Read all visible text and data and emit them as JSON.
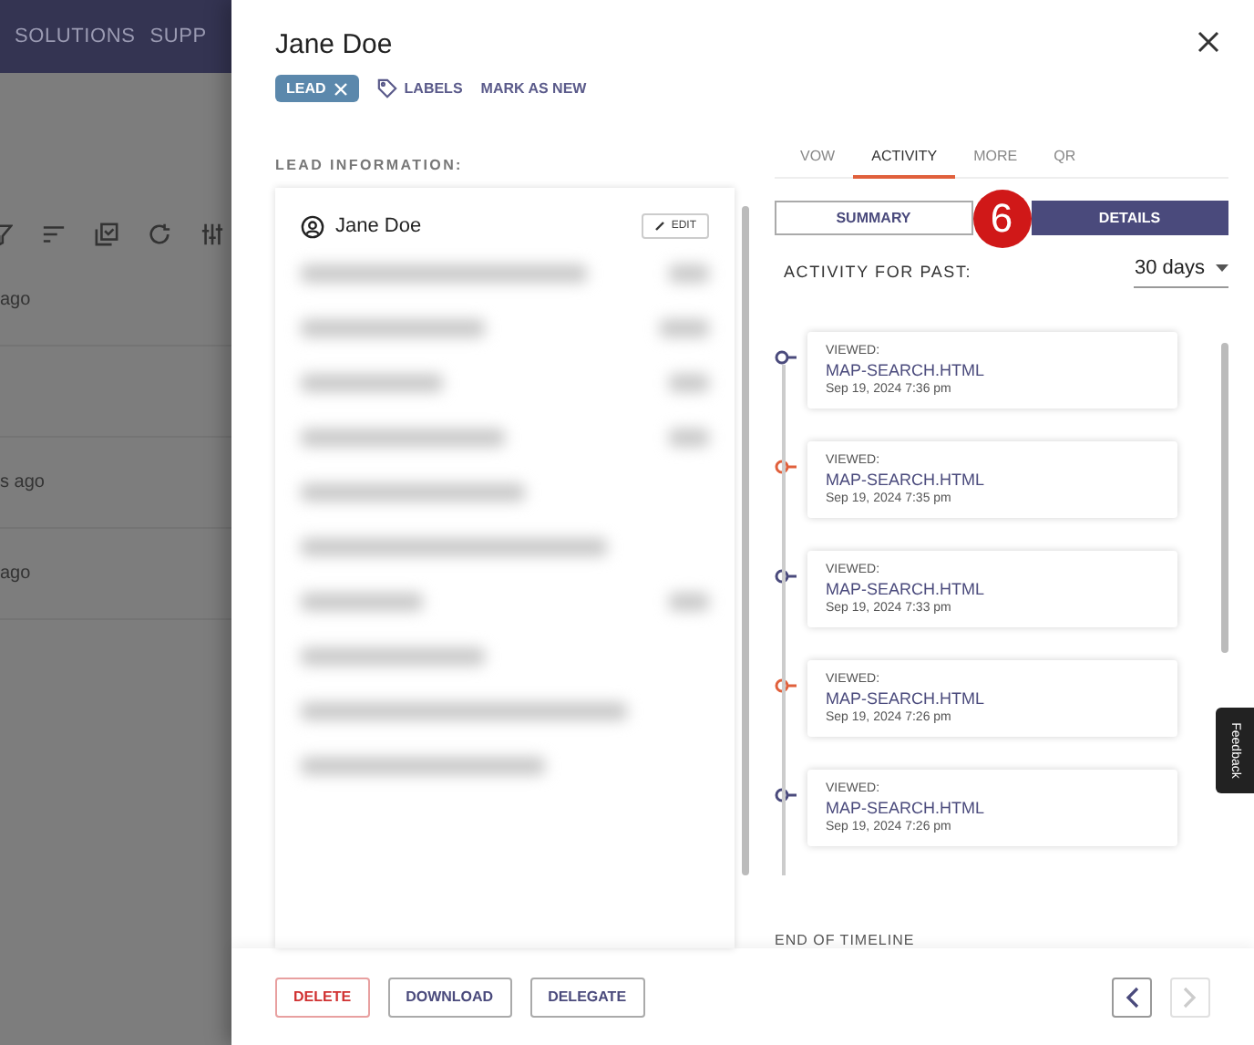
{
  "background_app": {
    "nav_items": [
      "SOLUTIONS",
      "SUPP"
    ],
    "rows": [
      "ago",
      "s ago",
      "ago"
    ]
  },
  "panel": {
    "title": "Jane Doe",
    "status_chip": "LEAD",
    "labels_link": "LABELS",
    "mark_new_link": "MARK AS NEW"
  },
  "lead_info": {
    "heading": "LEAD INFORMATION:",
    "name": "Jane Doe",
    "edit_button": "EDIT"
  },
  "tabs": [
    {
      "label": "VOW",
      "selected": false
    },
    {
      "label": "ACTIVITY",
      "selected": true
    },
    {
      "label": "MORE",
      "selected": false
    },
    {
      "label": "QR",
      "selected": false
    }
  ],
  "view_toggle": [
    {
      "label": "SUMMARY",
      "selected": false
    },
    {
      "label": "DETAILS",
      "selected": true
    }
  ],
  "annotation_badge": "6",
  "activity_filter": {
    "label": "ACTIVITY FOR PAST:",
    "value": "30 days"
  },
  "timeline": [
    {
      "action": "VIEWED:",
      "page": "MAP-SEARCH.HTML",
      "time": "Sep 19, 2024 7:36 pm",
      "color": "#4a4a7c"
    },
    {
      "action": "VIEWED:",
      "page": "MAP-SEARCH.HTML",
      "time": "Sep 19, 2024 7:35 pm",
      "color": "#e0603c"
    },
    {
      "action": "VIEWED:",
      "page": "MAP-SEARCH.HTML",
      "time": "Sep 19, 2024 7:33 pm",
      "color": "#4a4a7c"
    },
    {
      "action": "VIEWED:",
      "page": "MAP-SEARCH.HTML",
      "time": "Sep 19, 2024 7:26 pm",
      "color": "#e0603c"
    },
    {
      "action": "VIEWED:",
      "page": "MAP-SEARCH.HTML",
      "time": "Sep 19, 2024 7:26 pm",
      "color": "#4a4a7c"
    }
  ],
  "timeline_end": "END OF TIMELINE",
  "footer": {
    "buttons": [
      {
        "label": "DELETE",
        "kind": "danger"
      },
      {
        "label": "DOWNLOAD",
        "kind": "normal"
      },
      {
        "label": "DELEGATE",
        "kind": "normal"
      }
    ],
    "prev_disabled": false,
    "next_disabled": true
  },
  "feedback_tab": "Feedback"
}
